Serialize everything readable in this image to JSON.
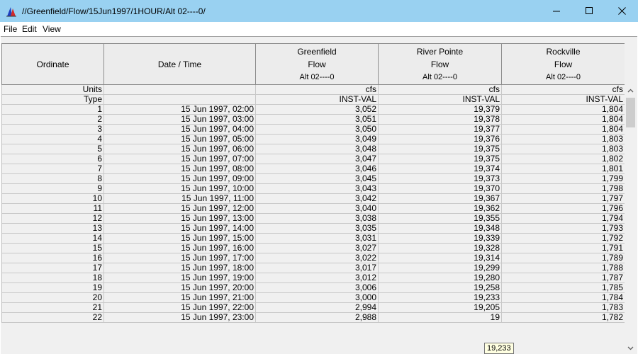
{
  "window": {
    "title": "//Greenfield/Flow/15Jun1997/1HOUR/Alt 02----0/",
    "icons": {
      "app": "hec-dss-icon",
      "minimize": "minimize-icon",
      "maximize": "maximize-icon",
      "close": "close-icon"
    }
  },
  "menu": [
    {
      "label": "File"
    },
    {
      "label": "Edit"
    },
    {
      "label": "View"
    }
  ],
  "table": {
    "columns": [
      {
        "lines": [
          "Ordinate"
        ]
      },
      {
        "lines": [
          "Date / Time"
        ]
      },
      {
        "lines": [
          "Greenfield",
          "Flow",
          "Alt 02----0"
        ]
      },
      {
        "lines": [
          "River Pointe",
          "Flow",
          "Alt 02----0"
        ]
      },
      {
        "lines": [
          "Rockville",
          "Flow",
          "Alt 02----0"
        ]
      }
    ],
    "meta_rows": [
      [
        "Units",
        "",
        "cfs",
        "cfs",
        "cfs"
      ],
      [
        "Type",
        "",
        "INST-VAL",
        "INST-VAL",
        "INST-VAL"
      ]
    ],
    "rows": [
      [
        "1",
        "15 Jun 1997, 02:00",
        "3,052",
        "19,379",
        "1,804"
      ],
      [
        "2",
        "15 Jun 1997, 03:00",
        "3,051",
        "19,378",
        "1,804"
      ],
      [
        "3",
        "15 Jun 1997, 04:00",
        "3,050",
        "19,377",
        "1,804"
      ],
      [
        "4",
        "15 Jun 1997, 05:00",
        "3,049",
        "19,376",
        "1,803"
      ],
      [
        "5",
        "15 Jun 1997, 06:00",
        "3,048",
        "19,375",
        "1,803"
      ],
      [
        "6",
        "15 Jun 1997, 07:00",
        "3,047",
        "19,375",
        "1,802"
      ],
      [
        "7",
        "15 Jun 1997, 08:00",
        "3,046",
        "19,374",
        "1,801"
      ],
      [
        "8",
        "15 Jun 1997, 09:00",
        "3,045",
        "19,373",
        "1,799"
      ],
      [
        "9",
        "15 Jun 1997, 10:00",
        "3,043",
        "19,370",
        "1,798"
      ],
      [
        "10",
        "15 Jun 1997, 11:00",
        "3,042",
        "19,367",
        "1,797"
      ],
      [
        "11",
        "15 Jun 1997, 12:00",
        "3,040",
        "19,362",
        "1,796"
      ],
      [
        "12",
        "15 Jun 1997, 13:00",
        "3,038",
        "19,355",
        "1,794"
      ],
      [
        "13",
        "15 Jun 1997, 14:00",
        "3,035",
        "19,348",
        "1,793"
      ],
      [
        "14",
        "15 Jun 1997, 15:00",
        "3,031",
        "19,339",
        "1,792"
      ],
      [
        "15",
        "15 Jun 1997, 16:00",
        "3,027",
        "19,328",
        "1,791"
      ],
      [
        "16",
        "15 Jun 1997, 17:00",
        "3,022",
        "19,314",
        "1,789"
      ],
      [
        "17",
        "15 Jun 1997, 18:00",
        "3,017",
        "19,299",
        "1,788"
      ],
      [
        "18",
        "15 Jun 1997, 19:00",
        "3,012",
        "19,280",
        "1,787"
      ],
      [
        "19",
        "15 Jun 1997, 20:00",
        "3,006",
        "19,258",
        "1,785"
      ],
      [
        "20",
        "15 Jun 1997, 21:00",
        "3,000",
        "19,233",
        "1,784"
      ],
      [
        "21",
        "15 Jun 1997, 22:00",
        "2,994",
        "19,205",
        "1,783"
      ],
      [
        "22",
        "15 Jun 1997, 23:00",
        "2,988",
        "19",
        "1,782"
      ]
    ]
  },
  "tooltip": {
    "text": "19,233"
  },
  "scrollbar": {
    "up_icon": "scroll-up-icon",
    "down_icon": "scroll-down-icon"
  },
  "colors": {
    "titlebar": "#99d1f1",
    "header_bg": "#ececec",
    "tooltip_bg": "#ffffe1"
  }
}
